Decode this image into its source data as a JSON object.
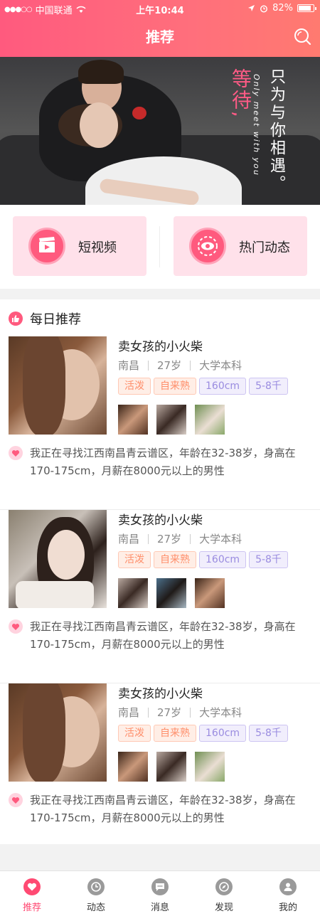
{
  "status_bar": {
    "carrier": "中国联通",
    "time": "上午10:44",
    "battery": "82%"
  },
  "nav": {
    "title": "推荐"
  },
  "banner": {
    "pink_text": "等待,",
    "white_text": "只为与你相遇。",
    "english_text": "Only meet with you"
  },
  "quick_entries": [
    {
      "label": "短视频",
      "icon": "video-clapper-icon"
    },
    {
      "label": "热门动态",
      "icon": "eye-target-icon"
    }
  ],
  "daily": {
    "title": "每日推荐",
    "cards": [
      {
        "name": "卖女孩的小火柴",
        "city": "南昌",
        "age": "27岁",
        "education": "大学本科",
        "tags": [
          "活泼",
          "自来熟",
          "160cm",
          "5-8千"
        ],
        "seek": "我正在寻找江西南昌青云谱区，年龄在32-38岁，身高在170-175cm，月薪在8000元以上的男性"
      },
      {
        "name": "卖女孩的小火柴",
        "city": "南昌",
        "age": "27岁",
        "education": "大学本科",
        "tags": [
          "活泼",
          "自来熟",
          "160cm",
          "5-8千"
        ],
        "seek": "我正在寻找江西南昌青云谱区，年龄在32-38岁，身高在170-175cm，月薪在8000元以上的男性"
      },
      {
        "name": "卖女孩的小火柴",
        "city": "南昌",
        "age": "27岁",
        "education": "大学本科",
        "tags": [
          "活泼",
          "自来熟",
          "160cm",
          "5-8千"
        ],
        "seek": "我正在寻找江西南昌青云谱区，年龄在32-38岁，身高在170-175cm，月薪在8000元以上的男性"
      }
    ]
  },
  "tabbar": [
    {
      "label": "推荐",
      "icon": "heart-icon",
      "active": true
    },
    {
      "label": "动态",
      "icon": "clock-icon",
      "active": false
    },
    {
      "label": "消息",
      "icon": "chat-icon",
      "active": false
    },
    {
      "label": "发现",
      "icon": "compass-icon",
      "active": false
    },
    {
      "label": "我的",
      "icon": "user-icon",
      "active": false
    }
  ],
  "colors": {
    "accent": "#ff4a73",
    "header_start": "#ff5a7e",
    "header_end": "#ff7a70",
    "tag_orange": "#ff8f6b",
    "tag_purple": "#9a8ce0"
  }
}
